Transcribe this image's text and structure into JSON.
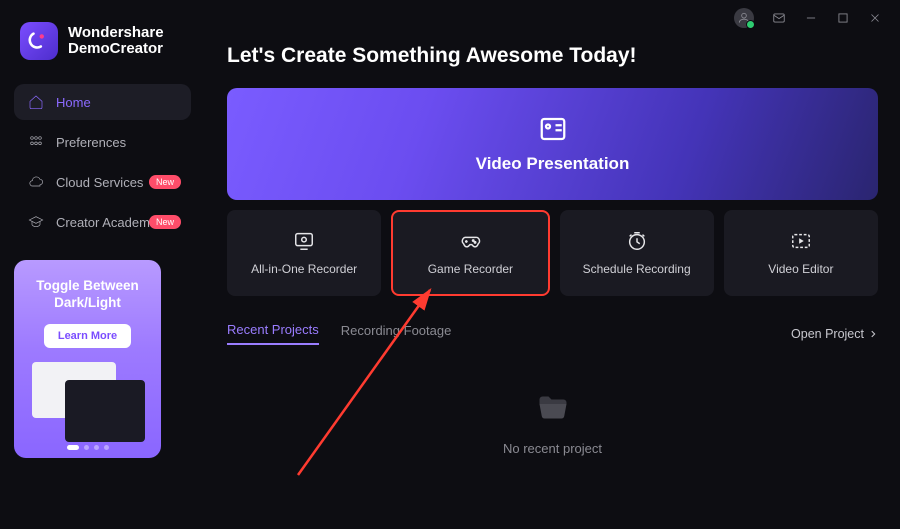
{
  "app": {
    "name_l1": "Wondershare",
    "name_l2": "DemoCreator"
  },
  "sidebar": {
    "items": [
      {
        "label": "Home"
      },
      {
        "label": "Preferences"
      },
      {
        "label": "Cloud Services",
        "badge": "New"
      },
      {
        "label": "Creator Academ...",
        "badge": "New"
      }
    ]
  },
  "promo": {
    "title_l1": "Toggle Between",
    "title_l2": "Dark/Light",
    "cta": "Learn More"
  },
  "main": {
    "heading": "Let's Create Something Awesome Today!",
    "hero": {
      "label": "Video Presentation"
    },
    "cards": [
      {
        "label": "All-in-One Recorder"
      },
      {
        "label": "Game Recorder"
      },
      {
        "label": "Schedule Recording"
      },
      {
        "label": "Video Editor"
      }
    ],
    "tabs": [
      {
        "label": "Recent Projects"
      },
      {
        "label": "Recording Footage"
      }
    ],
    "open_project": "Open Project",
    "empty": "No recent project"
  }
}
